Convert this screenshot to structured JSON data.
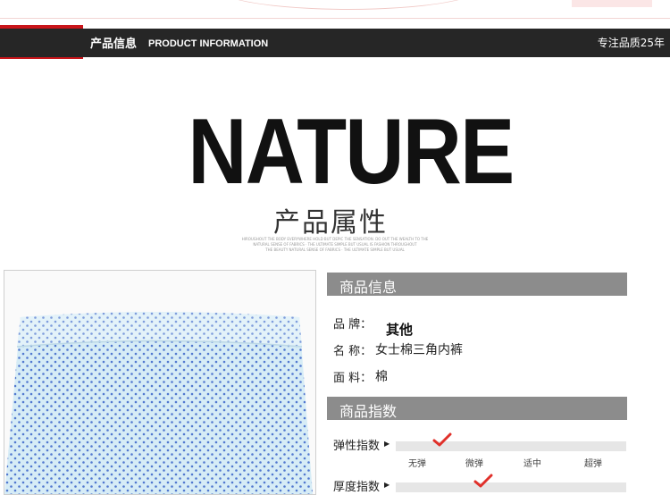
{
  "header": {
    "title_cn": "产品信息",
    "title_en": "PRODUCT INFORMATION",
    "right_text": "专注品质25年"
  },
  "hero": {
    "title": "NATURE",
    "subtitle": "产品属性",
    "small_lines": [
      "HIROUGHOUT THE BODY EVERYWHERE HOLD BUT DEPIC THE SENSATION. DO OUT THE WEALTH TO THE",
      "NATURAL SENSE OF FABRICS · THE ULTIMATE SIMPLE BUT USUAL IS FASHION THROUGHOUT",
      "THE BEAUTY NATURAL SENSE OF FABRICS · THE ULTIMATE SIMPLE BUT USUAL"
    ]
  },
  "product_info": {
    "heading": "商品信息",
    "brand_label": "品 牌：",
    "brand_value": "其他",
    "name_label": "名 称：",
    "name_value": "女士棉三角内裤",
    "material_label": "面 料：",
    "material_value": "棉"
  },
  "product_index": {
    "heading": "商品指数",
    "elasticity_label": "弹性指数",
    "elasticity_level": 0.2,
    "ticks": [
      "无弹",
      "微弹",
      "适中",
      "超弹"
    ],
    "thickness_label": "厚度指数",
    "thickness_level": 0.38
  },
  "colors": {
    "accent_red": "#c9151a",
    "header_dark": "#262626",
    "section_gray": "#8c8c8c",
    "check_red": "#e0302a",
    "fabric_blue": "#d6ecf6",
    "dot_blue": "#3a63c8"
  },
  "icons": {
    "arrow": "triangle-right-icon",
    "check": "red-check-icon"
  }
}
